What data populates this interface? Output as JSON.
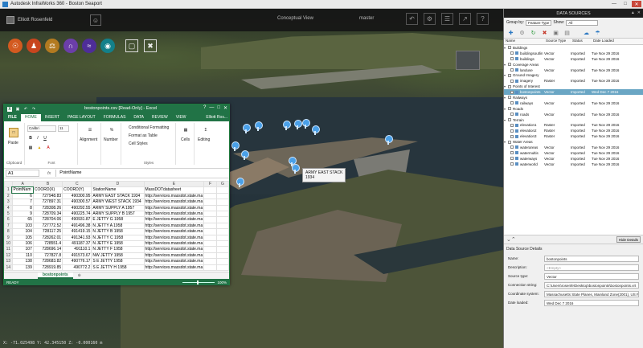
{
  "window": {
    "title": "Autodesk InfraWorks 360 - Boston Seaport",
    "min": "—",
    "max": "□",
    "close": "✕"
  },
  "topbar": {
    "user": "Elliott Rosenfeld",
    "view_label": "Conceptual View",
    "model_label": "master"
  },
  "viewport": {
    "tooltip_title": "ARMY EAST STACK",
    "tooltip_sub": "1934",
    "coordinates": "X: -71.025498 Y: 42.345150 Z: -0.000160 m"
  },
  "excel": {
    "filename": "bostonpoints.csv [Read-Only] - Excel",
    "win_btns": [
      "?",
      "—",
      "□",
      "✕"
    ],
    "tabs": [
      "FILE",
      "HOME",
      "INSERT",
      "PAGE LAYOUT",
      "FORMULAS",
      "DATA",
      "REVIEW",
      "VIEW"
    ],
    "user": "Elliott Ros...",
    "ribbon": {
      "paste": "Paste",
      "font_name": "Calibri",
      "font_size": "11",
      "bold": "B",
      "italic": "I",
      "underline": "U",
      "alignment": "Alignment",
      "number": "Number",
      "cond_format": "Conditional Formatting",
      "format_table": "Format as Table",
      "cell_styles": "Cell Styles",
      "cells": "Cells",
      "editing": "Editing",
      "groups": [
        "Clipboard",
        "Font",
        "Styles"
      ]
    },
    "namebox": "A1",
    "fx": "fx",
    "formula_value": "PointName",
    "columns": [
      "A",
      "B",
      "C",
      "D",
      "E",
      "F",
      "G"
    ],
    "rows": [
      [
        "1",
        "PointNam",
        "COORD(X)",
        "COORD(Y)",
        "StationName",
        "MassDOTdatasheet",
        "",
        ""
      ],
      [
        "2",
        "6",
        "727948.83",
        "490300.95",
        "ARMY EAST STACK 1934",
        "http://services.massdot.state.ma",
        "",
        ""
      ],
      [
        "3",
        "7",
        "727897.31",
        "490300.57",
        "ARMY WEST STACK 1934",
        "http://services.massdot.state.ma",
        "",
        ""
      ],
      [
        "4",
        "8",
        "728308.26",
        "490292.55",
        "ARMY SUPPLY A 1957",
        "http://services.massdot.state.ma",
        "",
        ""
      ],
      [
        "5",
        "9",
        "728709.34",
        "490225.74",
        "ARMY SUPPLY B 1957",
        "http://services.massdot.state.ma",
        "",
        ""
      ],
      [
        "6",
        "65",
        "728704.06",
        "490931.87",
        "E JETTY G 1958",
        "http://services.massdot.state.ma",
        "",
        ""
      ],
      [
        "7",
        "103",
        "727772.52",
        "491496.38",
        "N JETTY A 1958",
        "http://services.massdot.state.ma",
        "",
        ""
      ],
      [
        "8",
        "104",
        "728117.25",
        "491419.15",
        "N JETTY B 1958",
        "http://services.massdot.state.ma",
        "",
        ""
      ],
      [
        "9",
        "105",
        "728262.01",
        "491341.93",
        "N JETTY C 1958",
        "http://services.massdot.state.ma",
        "",
        ""
      ],
      [
        "10",
        "106",
        "728551.4",
        "491187.37",
        "N JETTY E 1958",
        "http://services.massdot.state.ma",
        "",
        ""
      ],
      [
        "11",
        "107",
        "728696.14",
        "491110.1",
        "N JETTY F 1958",
        "http://services.massdot.state.ma",
        "",
        ""
      ],
      [
        "12",
        "110",
        "727827.8",
        "491573.67",
        "NW JETTY 1958",
        "http://services.massdot.state.ma",
        "",
        ""
      ],
      [
        "13",
        "138",
        "728683.82",
        "490776.17",
        "S E JETTY 1958",
        "http://services.massdot.state.ma",
        "",
        ""
      ],
      [
        "14",
        "139",
        "728919.85",
        "490772.2",
        "S E JETTY H 1958",
        "http://services.massdot.state.ma",
        "",
        ""
      ]
    ],
    "sheet_tab": "bostonpoints",
    "add_sheet": "⊕",
    "status": "READY",
    "zoom": "100%"
  },
  "panel": {
    "title": "DATA SOURCES",
    "group_by_label": "Group by:",
    "group_by_value": "Feature Type",
    "show_label": "Show:",
    "show_value": "All",
    "col_name": "Name",
    "col_type": "Source Type",
    "col_status": "Status",
    "col_date": "Date Loaded",
    "tree": [
      {
        "kind": "group",
        "name": "Buildings"
      },
      {
        "kind": "item",
        "name": "buildingsoutlin",
        "type": "Vector",
        "status": "Imported",
        "date": "Tue Nov 29 2016"
      },
      {
        "kind": "item",
        "name": "buildings",
        "type": "Vector",
        "status": "Imported",
        "date": "Tue Nov 29 2016"
      },
      {
        "kind": "group",
        "name": "Coverage Areas"
      },
      {
        "kind": "item",
        "name": "landuse",
        "type": "Vector",
        "status": "Imported",
        "date": "Tue Nov 29 2016"
      },
      {
        "kind": "group",
        "name": "Ground Imagery"
      },
      {
        "kind": "item",
        "name": "imagery",
        "type": "Raster",
        "status": "Imported",
        "date": "Tue Nov 29 2016"
      },
      {
        "kind": "group",
        "name": "Points of Interest"
      },
      {
        "kind": "item",
        "name": "bostonpoints",
        "type": "Vector",
        "status": "Imported",
        "date": "Wed Dec 7 2016",
        "selected": true
      },
      {
        "kind": "group",
        "name": "Railways"
      },
      {
        "kind": "item",
        "name": "railways",
        "type": "Vector",
        "status": "Imported",
        "date": "Tue Nov 29 2016"
      },
      {
        "kind": "group",
        "name": "Roads"
      },
      {
        "kind": "item",
        "name": "roads",
        "type": "Vector",
        "status": "Imported",
        "date": "Tue Nov 29 2016"
      },
      {
        "kind": "group",
        "name": "Terrain"
      },
      {
        "kind": "item",
        "name": "elevation1",
        "type": "Raster",
        "status": "Imported",
        "date": "Tue Nov 29 2016"
      },
      {
        "kind": "item",
        "name": "elevation2",
        "type": "Raster",
        "status": "Imported",
        "date": "Tue Nov 29 2016"
      },
      {
        "kind": "item",
        "name": "elevation3",
        "type": "Raster",
        "status": "Imported",
        "date": "Tue Nov 29 2016"
      },
      {
        "kind": "group",
        "name": "Water Areas"
      },
      {
        "kind": "item",
        "name": "waterareas",
        "type": "Vector",
        "status": "Imported",
        "date": "Tue Nov 29 2016"
      },
      {
        "kind": "item",
        "name": "watermultis",
        "type": "Vector",
        "status": "Imported",
        "date": "Tue Nov 29 2016"
      },
      {
        "kind": "item",
        "name": "waterways",
        "type": "Vector",
        "status": "Imported",
        "date": "Tue Nov 29 2016"
      },
      {
        "kind": "item",
        "name": "waterworld",
        "type": "Vector",
        "status": "Imported",
        "date": "Tue Nov 29 2016"
      }
    ],
    "hide_details": "Hide Details",
    "details_title": "Data Source Details",
    "details": [
      {
        "label": "Name:",
        "value": "bostonpoints"
      },
      {
        "label": "Description:",
        "value": "<Empty>",
        "placeholder": true
      },
      {
        "label": "Source type:",
        "value": "Vector"
      },
      {
        "label": "Connection string:",
        "value": "C:\\Users\\rosenfe\\Desktop\\bostonpoints\\bostonpoints.vrt"
      },
      {
        "label": "Coordinate system:",
        "value": "Massachusetts State Planes, Mainland Zone(2001), US Foot)"
      },
      {
        "label": "Date loaded:",
        "value": "Wed Dec 7 2016"
      }
    ]
  },
  "colors": {
    "excel_green": "#217346",
    "pin_blue": "#4aa0e8",
    "selection": "#6aa6c4"
  }
}
